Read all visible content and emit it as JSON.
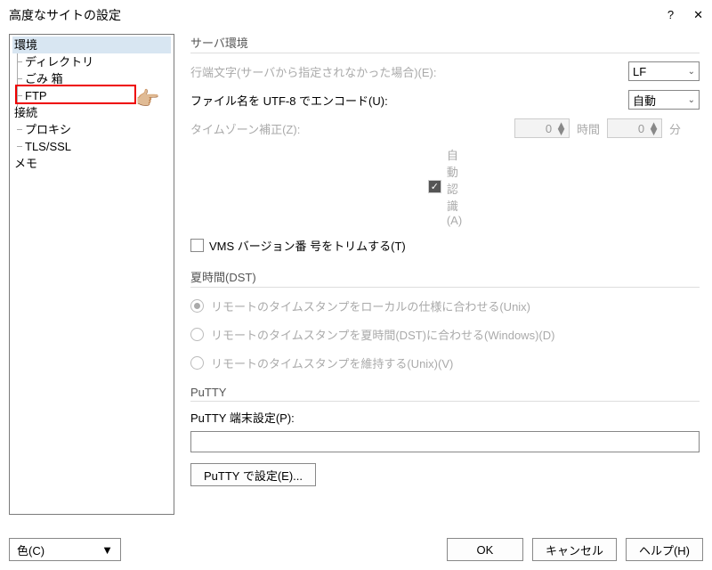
{
  "title": "高度なサイトの設定",
  "nav": {
    "items": [
      {
        "label": "環境",
        "level": 0,
        "selected": true
      },
      {
        "label": "ディレクトリ",
        "level": 1
      },
      {
        "label": "ごみ 箱",
        "level": 1
      },
      {
        "label": "FTP",
        "level": 1
      },
      {
        "label": "接続",
        "level": 0
      },
      {
        "label": "プロキシ",
        "level": 1
      },
      {
        "label": "TLS/SSL",
        "level": 1
      },
      {
        "label": "メモ",
        "level": 0
      }
    ]
  },
  "server_env": {
    "title": "サーバ環境",
    "eol_label": "行端文字(サーバから指定されなかった場合)(E):",
    "eol_value": "LF",
    "utf8_label": "ファイル名を UTF-8 でエンコード(U):",
    "utf8_value": "自動",
    "tz_label": "タイムゾーン補正(Z):",
    "tz_hours": "0",
    "tz_hours_unit": "時間",
    "tz_mins": "0",
    "tz_mins_unit": "分",
    "auto_detect": "自動認識(A)",
    "vms_label": "VMS バージョン番 号をトリムする(T)"
  },
  "dst": {
    "title": "夏時間(DST)",
    "opt1": "リモートのタイムスタンプをローカルの仕様に合わせる(Unix)",
    "opt2": "リモートのタイムスタンプを夏時間(DST)に合わせる(Windows)(D)",
    "opt3": "リモートのタイムスタンプを維持する(Unix)(V)"
  },
  "putty": {
    "title": "PuTTY",
    "terminal_label": "PuTTY 端末設定(P):",
    "config_btn": "PuTTY で設定(E)..."
  },
  "footer": {
    "color": "色(C)",
    "ok": "OK",
    "cancel": "キャンセル",
    "help": "ヘルプ(H)"
  }
}
